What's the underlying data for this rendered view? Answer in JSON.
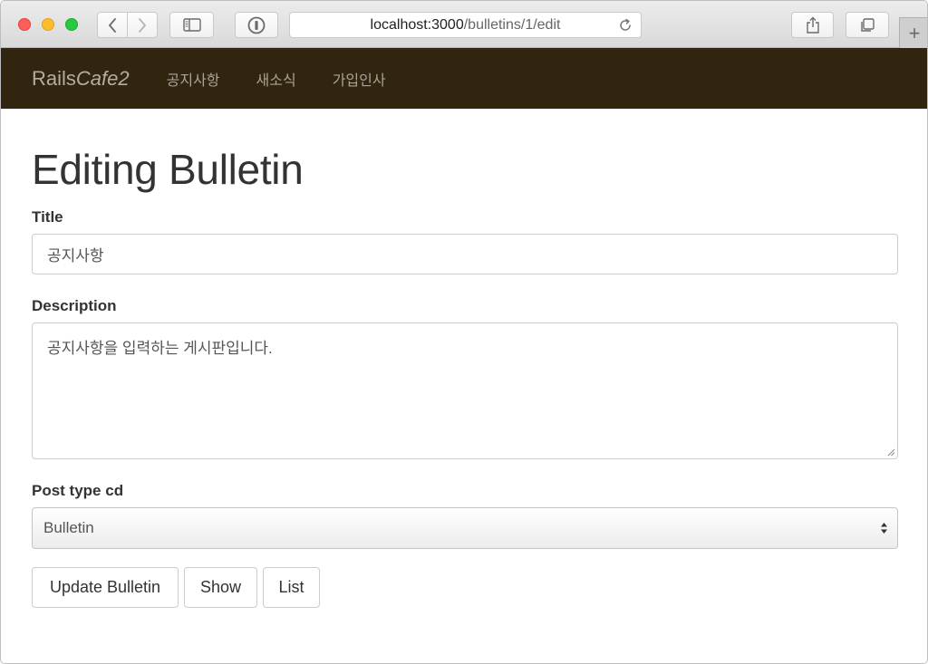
{
  "browser": {
    "url_host": "localhost:3000",
    "url_path": "/bulletins/1/edit",
    "new_tab": "+"
  },
  "navbar": {
    "brand_plain": "Rails",
    "brand_italic": "Cafe2",
    "items": [
      {
        "label": "공지사항"
      },
      {
        "label": "새소식"
      },
      {
        "label": "가입인사"
      }
    ],
    "background": "#32250f"
  },
  "page": {
    "title": "Editing Bulletin"
  },
  "form": {
    "title_label": "Title",
    "title_value": "공지사항",
    "description_label": "Description",
    "description_value": "공지사항을 입력하는 게시판입니다.",
    "post_type_label": "Post type cd",
    "post_type_value": "Bulletin"
  },
  "actions": {
    "update_label": "Update Bulletin",
    "show_label": "Show",
    "list_label": "List"
  }
}
